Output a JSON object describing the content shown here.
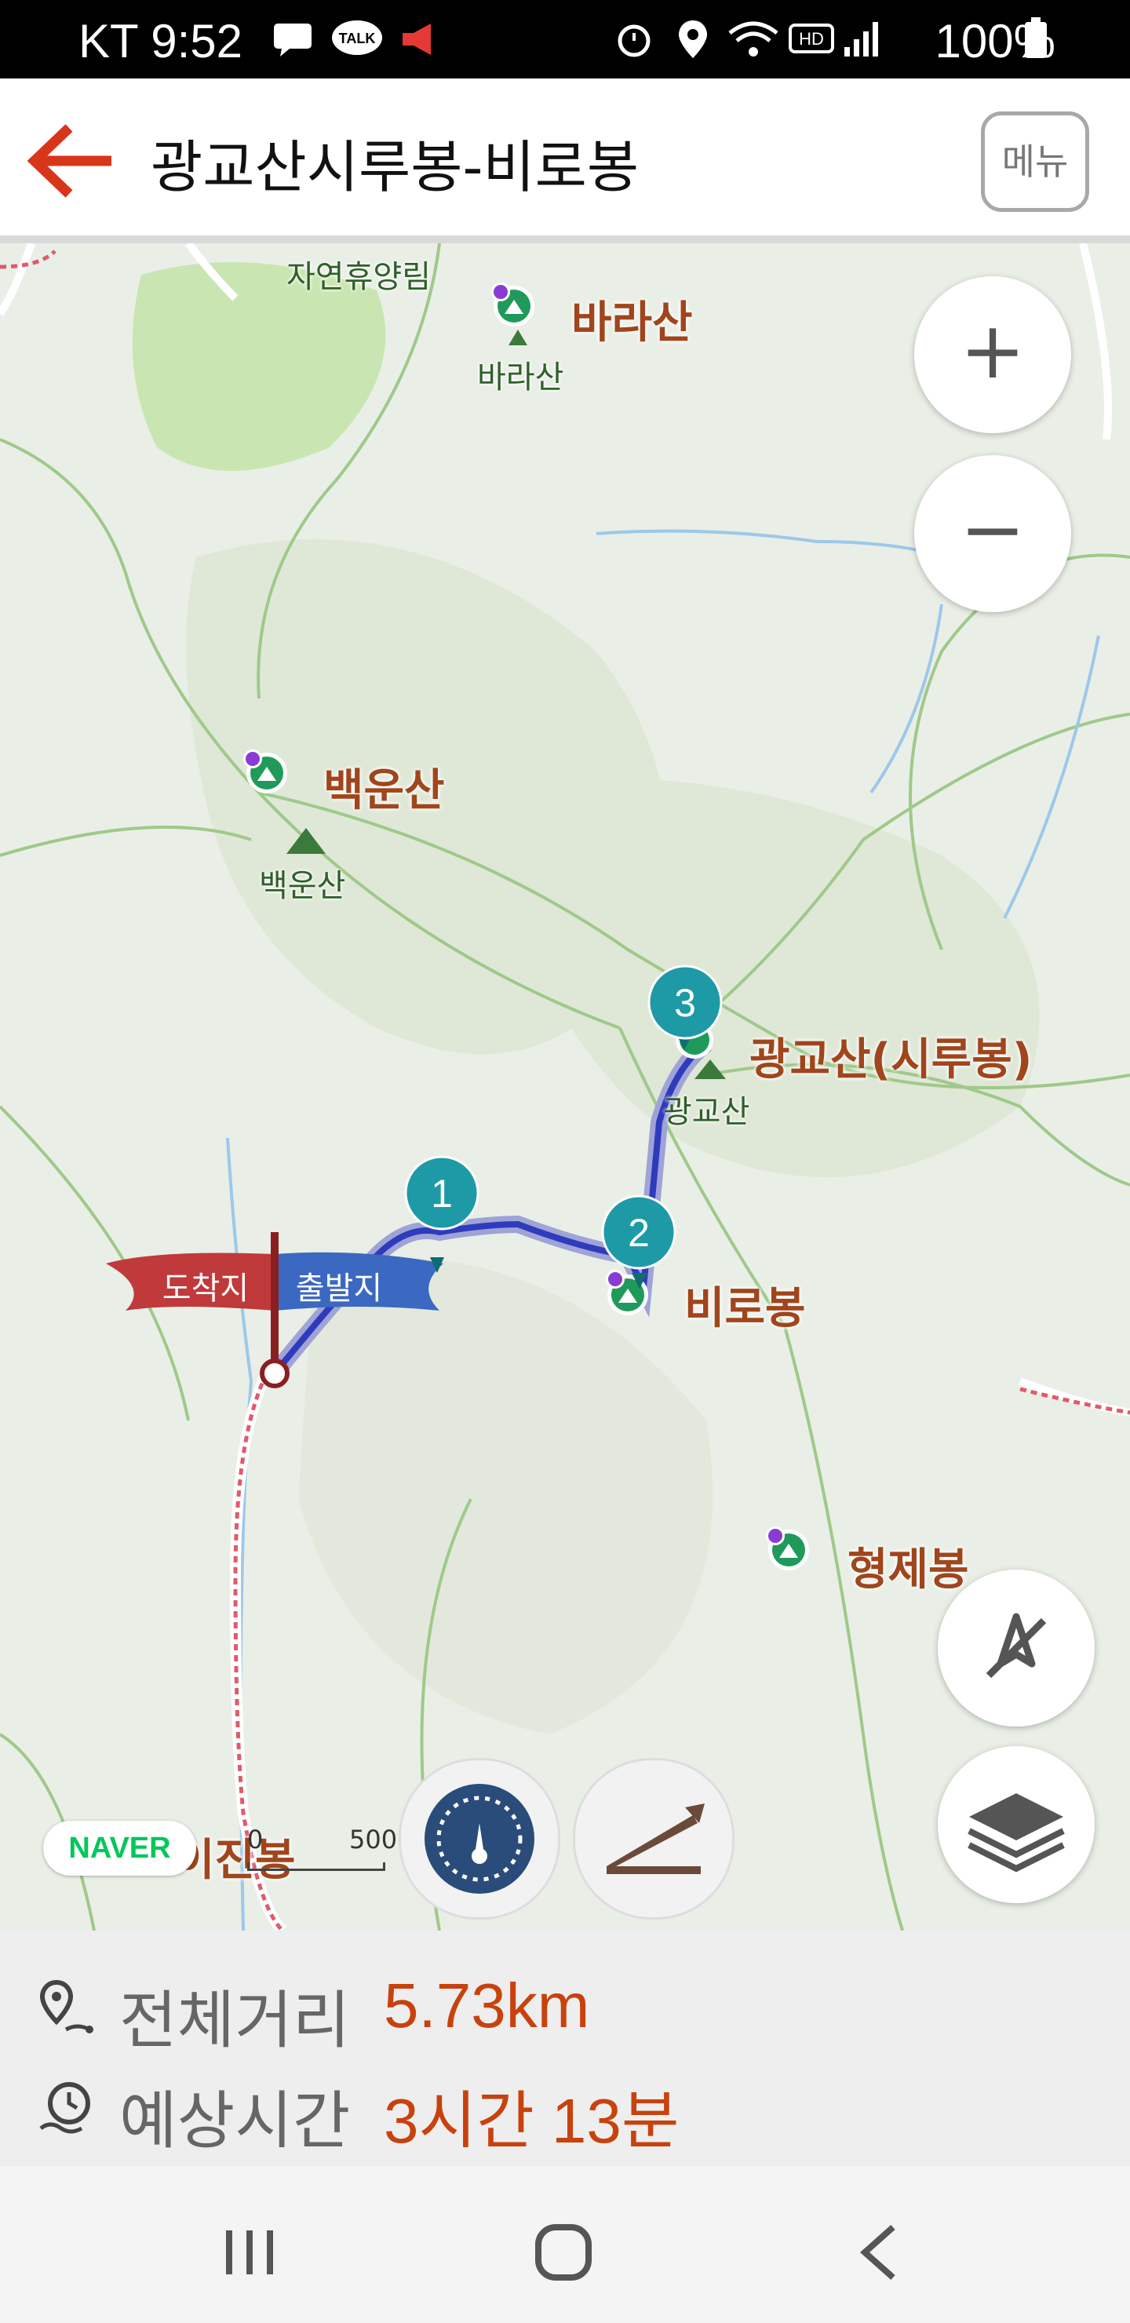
{
  "status": {
    "carrier_time": "KT 9:52",
    "battery": "100%",
    "talk": "TALK",
    "hd": "HD"
  },
  "header": {
    "title": "광교산시루봉-비로봉",
    "menu_label": "메뉴"
  },
  "map": {
    "peaks": [
      {
        "name": "바라산",
        "sub": "바라산"
      },
      {
        "name": "백운산",
        "sub": "백운산"
      },
      {
        "name": "광교산(시루봉)",
        "sub": "광교산"
      },
      {
        "name": "비로봉"
      },
      {
        "name": "형제봉"
      },
      {
        "name": "이진봉"
      }
    ],
    "forest_label": "자연휴양림",
    "flag_arrival": "도착지",
    "flag_departure": "출발지",
    "waypoints": [
      "1",
      "2",
      "3"
    ],
    "zoom_in": "+",
    "zoom_out": "−",
    "naver_logo": "NAVER",
    "scale_start": "0",
    "scale_end": "500"
  },
  "info": {
    "distance_label": "전체거리",
    "distance_value": "5.73km",
    "time_label": "예상시간",
    "time_value": "3시간 13분"
  },
  "colors": {
    "accent": "#c8420e",
    "route": "#2f3bbd",
    "marker": "#1d9aa6",
    "peak": "#1f9a5a"
  }
}
